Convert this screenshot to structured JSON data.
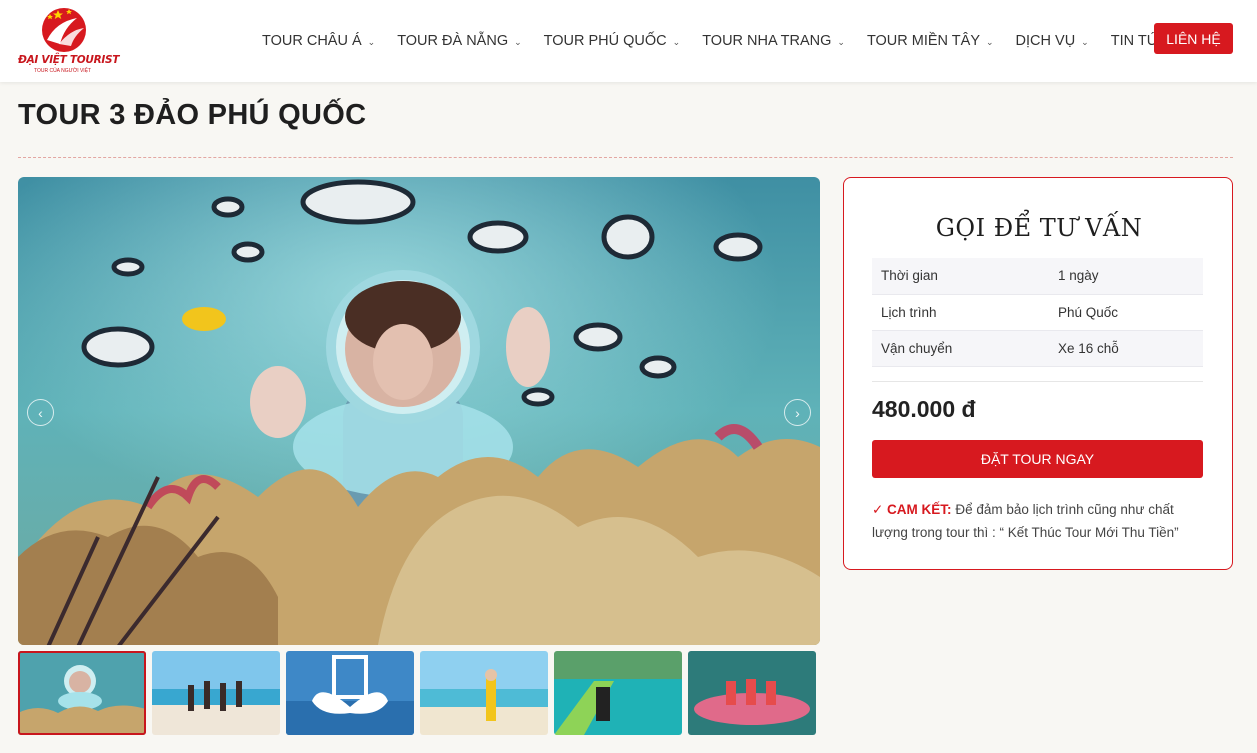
{
  "brand": {
    "name": "ĐẠI VIỆT TOURIST",
    "tagline": "TOUR CỦA NGƯỜI VIỆT"
  },
  "nav": {
    "items": [
      {
        "label": "TOUR CHÂU Á"
      },
      {
        "label": "TOUR ĐÀ NẴNG"
      },
      {
        "label": "TOUR PHÚ QUỐC"
      },
      {
        "label": "TOUR NHA TRANG"
      },
      {
        "label": "TOUR MIỀN TÂY"
      },
      {
        "label": "DỊCH VỤ"
      },
      {
        "label": "TIN TỨC"
      }
    ],
    "contact_label": "LIÊN HỆ"
  },
  "page": {
    "title": "TOUR 3 ĐẢO PHÚ QUỐC"
  },
  "gallery": {
    "thumb_count": 6,
    "active_index": 0
  },
  "consult": {
    "title": "GỌI ĐỂ TƯ VẤN",
    "rows": [
      {
        "label": "Thời gian",
        "value": "1 ngày"
      },
      {
        "label": "Lịch trình",
        "value": "Phú Quốc"
      },
      {
        "label": "Vận chuyển",
        "value": "Xe 16 chỗ"
      }
    ],
    "price": "480.000 đ",
    "book_label": "ĐẶT TOUR NGAY",
    "commit_label": "✓ CAM KẾT:",
    "commit_text": " Để đảm bảo lịch trình cũng như chất lượng trong tour thì : “ Kết Thúc Tour Mới Thu Tiền”"
  },
  "colors": {
    "accent": "#d7191f",
    "background": "#f8f7f3"
  }
}
